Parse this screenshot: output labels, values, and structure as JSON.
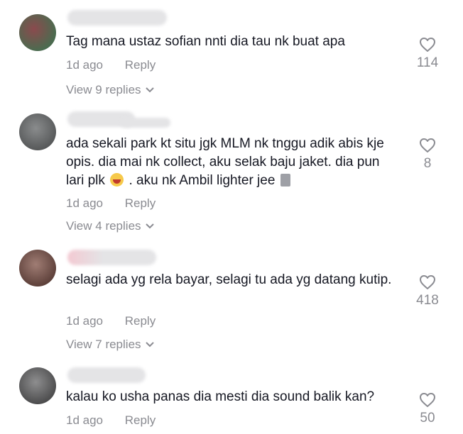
{
  "comments": [
    {
      "text": "Tag mana ustaz sofian nnti dia tau nk buat apa",
      "time": "1d ago",
      "reply_label": "Reply",
      "likes": "114",
      "view_replies": "View 9 replies",
      "avatar_color": "#6c3f44"
    },
    {
      "text_before_emoji": "ada sekali park kt situ jgk MLM nk tnggu adik abis kje opis. dia mai nk collect, aku selak baju jaket. dia pun lari plk",
      "text_after_emoji": ". aku nk Ambil lighter jee",
      "time": "1d ago",
      "reply_label": "Reply",
      "likes": "8",
      "view_replies": "View 4 replies",
      "avatar_color": "#6d6f70"
    },
    {
      "text": "selagi ada yg rela bayar, selagi tu ada yg datang kutip.",
      "time": "1d ago",
      "reply_label": "Reply",
      "likes": "418",
      "view_replies": "View 7 replies",
      "avatar_color": "#7a5a52"
    },
    {
      "text": "kalau ko usha panas dia mesti dia sound balik kan?",
      "time": "1d ago",
      "reply_label": "Reply",
      "likes": "50",
      "avatar_color": "#5f5f60"
    }
  ],
  "icons": {
    "like": "heart-outline-icon",
    "expand": "chevron-down-icon"
  },
  "colors": {
    "text": "#161823",
    "muted": "#8a8b91"
  }
}
